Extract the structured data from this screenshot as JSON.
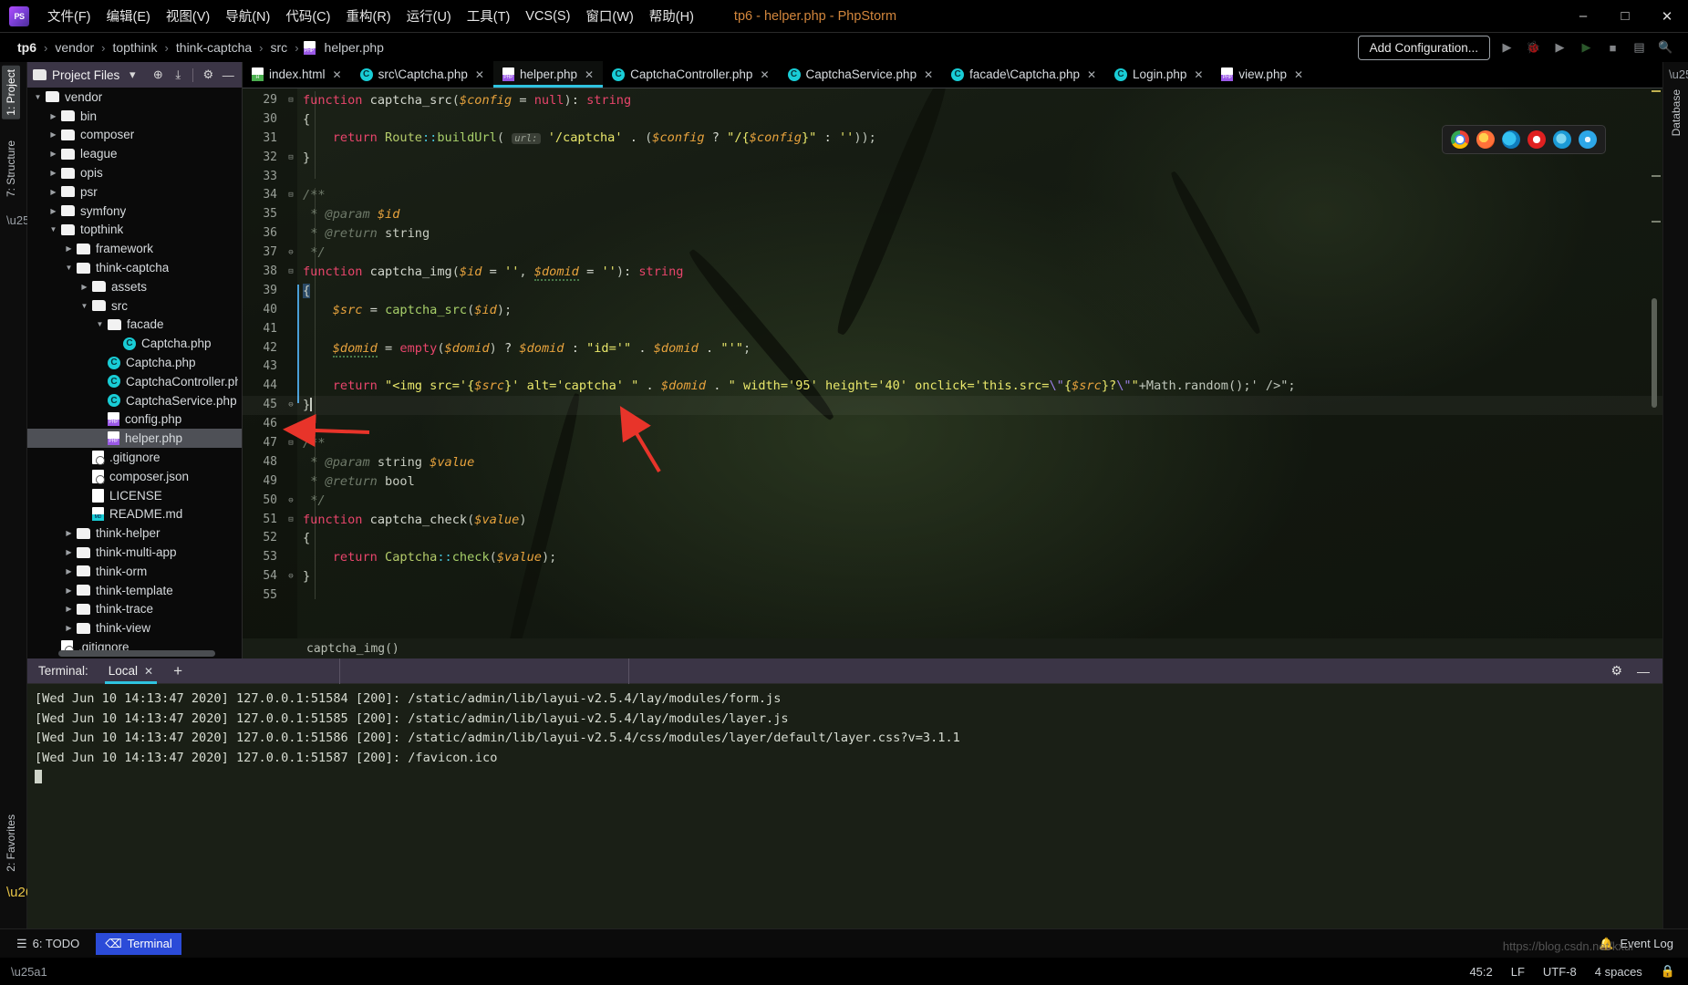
{
  "window": {
    "title": "tp6 - helper.php - PhpStorm",
    "logo_text": "PS",
    "minimize": "–",
    "maximize": "□",
    "close": "✕"
  },
  "menu": [
    {
      "label": "文件(F)",
      "name": "menu-file"
    },
    {
      "label": "编辑(E)",
      "name": "menu-edit"
    },
    {
      "label": "视图(V)",
      "name": "menu-view"
    },
    {
      "label": "导航(N)",
      "name": "menu-navigate"
    },
    {
      "label": "代码(C)",
      "name": "menu-code"
    },
    {
      "label": "重构(R)",
      "name": "menu-refactor"
    },
    {
      "label": "运行(U)",
      "name": "menu-run"
    },
    {
      "label": "工具(T)",
      "name": "menu-tools"
    },
    {
      "label": "VCS(S)",
      "name": "menu-vcs"
    },
    {
      "label": "窗口(W)",
      "name": "menu-window"
    },
    {
      "label": "帮助(H)",
      "name": "menu-help"
    }
  ],
  "breadcrumbs": {
    "items": [
      "tp6",
      "vendor",
      "topthink",
      "think-captcha",
      "src"
    ],
    "file": "helper.php",
    "separator": "›"
  },
  "toolbar": {
    "add_configuration": "Add Configuration...",
    "run": "▶",
    "debug": "🐞",
    "coverage": "▶",
    "profile": "▶",
    "stop": "■",
    "layout": "▤",
    "search": "🔍"
  },
  "left_stripe": {
    "project_tab": "1: Project",
    "structure_tab": "7: Structure",
    "favorites_tab": "2: Favorites"
  },
  "right_stripe": {
    "database_tab": "Database"
  },
  "project_panel": {
    "title": "Project Files",
    "dropdown_caret": "▾",
    "locate_icon": "⊕",
    "collapse_icon": "⤓",
    "settings_icon": "⚙",
    "hide_icon": "—",
    "tree": [
      {
        "label": "vendor",
        "indent": 1,
        "arrow": "down",
        "icon": "folder"
      },
      {
        "label": "bin",
        "indent": 2,
        "arrow": "right",
        "icon": "folder"
      },
      {
        "label": "composer",
        "indent": 2,
        "arrow": "right",
        "icon": "folder"
      },
      {
        "label": "league",
        "indent": 2,
        "arrow": "right",
        "icon": "folder"
      },
      {
        "label": "opis",
        "indent": 2,
        "arrow": "right",
        "icon": "folder"
      },
      {
        "label": "psr",
        "indent": 2,
        "arrow": "right",
        "icon": "folder"
      },
      {
        "label": "symfony",
        "indent": 2,
        "arrow": "right",
        "icon": "folder"
      },
      {
        "label": "topthink",
        "indent": 2,
        "arrow": "down",
        "icon": "folder"
      },
      {
        "label": "framework",
        "indent": 3,
        "arrow": "right",
        "icon": "folder"
      },
      {
        "label": "think-captcha",
        "indent": 3,
        "arrow": "down",
        "icon": "folder"
      },
      {
        "label": "assets",
        "indent": 4,
        "arrow": "right",
        "icon": "folder"
      },
      {
        "label": "src",
        "indent": 4,
        "arrow": "down",
        "icon": "folder"
      },
      {
        "label": "facade",
        "indent": 5,
        "arrow": "down",
        "icon": "folder"
      },
      {
        "label": "Captcha.php",
        "indent": 6,
        "arrow": "none",
        "icon": "class"
      },
      {
        "label": "Captcha.php",
        "indent": 5,
        "arrow": "none",
        "icon": "class"
      },
      {
        "label": "CaptchaController.php",
        "indent": 5,
        "arrow": "none",
        "icon": "class"
      },
      {
        "label": "CaptchaService.php",
        "indent": 5,
        "arrow": "none",
        "icon": "class"
      },
      {
        "label": "config.php",
        "indent": 5,
        "arrow": "none",
        "icon": "php"
      },
      {
        "label": "helper.php",
        "indent": 5,
        "arrow": "none",
        "icon": "php",
        "selected": true
      },
      {
        "label": ".gitignore",
        "indent": 4,
        "arrow": "none",
        "icon": "git"
      },
      {
        "label": "composer.json",
        "indent": 4,
        "arrow": "none",
        "icon": "git"
      },
      {
        "label": "LICENSE",
        "indent": 4,
        "arrow": "none",
        "icon": "license"
      },
      {
        "label": "README.md",
        "indent": 4,
        "arrow": "none",
        "icon": "md"
      },
      {
        "label": "think-helper",
        "indent": 3,
        "arrow": "right",
        "icon": "folder"
      },
      {
        "label": "think-multi-app",
        "indent": 3,
        "arrow": "right",
        "icon": "folder"
      },
      {
        "label": "think-orm",
        "indent": 3,
        "arrow": "right",
        "icon": "folder"
      },
      {
        "label": "think-template",
        "indent": 3,
        "arrow": "right",
        "icon": "folder"
      },
      {
        "label": "think-trace",
        "indent": 3,
        "arrow": "right",
        "icon": "folder"
      },
      {
        "label": "think-view",
        "indent": 3,
        "arrow": "right",
        "icon": "folder"
      },
      {
        "label": ".gitignore",
        "indent": 2,
        "arrow": "none",
        "icon": "git"
      }
    ]
  },
  "editor_tabs": [
    {
      "label": "index.html",
      "icon": "html",
      "active": false
    },
    {
      "label": "src\\Captcha.php",
      "icon": "class",
      "active": false
    },
    {
      "label": "helper.php",
      "icon": "php",
      "active": true
    },
    {
      "label": "CaptchaController.php",
      "icon": "class",
      "active": false
    },
    {
      "label": "CaptchaService.php",
      "icon": "class",
      "active": false
    },
    {
      "label": "facade\\Captcha.php",
      "icon": "class",
      "active": false
    },
    {
      "label": "Login.php",
      "icon": "class",
      "active": false
    },
    {
      "label": "view.php",
      "icon": "php",
      "active": false
    }
  ],
  "tab_close_glyph": "✕",
  "editor": {
    "first_line": 29,
    "breadcrumb": "captcha_img()",
    "lines": [
      {
        "n": 29,
        "fold": "⊟"
      },
      {
        "n": 30,
        "fold": ""
      },
      {
        "n": 31,
        "fold": ""
      },
      {
        "n": 32,
        "fold": "⊟"
      },
      {
        "n": 33,
        "fold": ""
      },
      {
        "n": 34,
        "fold": "⊟"
      },
      {
        "n": 35,
        "fold": ""
      },
      {
        "n": 36,
        "fold": ""
      },
      {
        "n": 37,
        "fold": "⊖"
      },
      {
        "n": 38,
        "fold": "⊟"
      },
      {
        "n": 39,
        "fold": ""
      },
      {
        "n": 40,
        "fold": ""
      },
      {
        "n": 41,
        "fold": ""
      },
      {
        "n": 42,
        "fold": ""
      },
      {
        "n": 43,
        "fold": ""
      },
      {
        "n": 44,
        "fold": ""
      },
      {
        "n": 45,
        "fold": "⊖",
        "current": true
      },
      {
        "n": 46,
        "fold": ""
      },
      {
        "n": 47,
        "fold": "⊟"
      },
      {
        "n": 48,
        "fold": ""
      },
      {
        "n": 49,
        "fold": ""
      },
      {
        "n": 50,
        "fold": "⊖"
      },
      {
        "n": 51,
        "fold": "⊟"
      },
      {
        "n": 52,
        "fold": ""
      },
      {
        "n": 53,
        "fold": ""
      },
      {
        "n": 54,
        "fold": "⊖"
      },
      {
        "n": 55,
        "fold": ""
      }
    ],
    "source_text": [
      "function captcha_src($config = null): string",
      "{",
      "    return Route::buildUrl( url: '/captcha' . ($config ? \"/{$config}\" : ''));",
      "}",
      "",
      "/**",
      " * @param $id",
      " * @return string",
      " */",
      "function captcha_img($id = '', $domid = ''): string",
      "{",
      "    $src = captcha_src($id);",
      "",
      "    $domid = empty($domid) ? $domid : \"id='\" . $domid . \"'\";",
      "",
      "    return \"<img src='{$src}' alt='captcha' \" . $domid . \" width='95' height='40' onclick='this.src=\\\"{$src}?\\\"+Math.random();' />\";",
      "}",
      "",
      "/**",
      " * @param string $value",
      " * @return bool",
      " */",
      "function captcha_check($value)",
      "{",
      "    return Captcha::check($value);",
      "}",
      ""
    ],
    "param_hint": "url:"
  },
  "terminal": {
    "label": "Terminal:",
    "tab": "Local",
    "tab_close": "✕",
    "add": "+",
    "settings_icon": "⚙",
    "hide_icon": "—",
    "lines": [
      "[Wed Jun 10 14:13:47 2020] 127.0.0.1:51584 [200]: /static/admin/lib/layui-v2.5.4/lay/modules/form.js",
      "[Wed Jun 10 14:13:47 2020] 127.0.0.1:51585 [200]: /static/admin/lib/layui-v2.5.4/lay/modules/layer.js",
      "[Wed Jun 10 14:13:47 2020] 127.0.0.1:51586 [200]: /static/admin/lib/layui-v2.5.4/css/modules/layer/default/layer.css?v=3.1.1",
      "[Wed Jun 10 14:13:47 2020] 127.0.0.1:51587 [200]: /favicon.ico"
    ]
  },
  "bottom_toolbar": {
    "todo": "6: TODO",
    "terminal": "Terminal",
    "event_log": "Event Log",
    "todo_icon": "☰",
    "terminal_icon": "⌫",
    "event_icon": "🔔"
  },
  "status_bar": {
    "caret_position": "45:2",
    "line_separator": "LF",
    "encoding": "UTF-8",
    "indent": "4 spaces",
    "lock_icon": "🔒",
    "watermark": "https://blog.csdn.net/kxul"
  },
  "colors": {
    "accent_cyan": "#2fc4e0",
    "title_orange": "#d2863c",
    "panel_purple": "#3b3546",
    "selection_blue": "#2b4bd8",
    "annotation_red": "#e8342a",
    "keyword_pink": "#e8456b",
    "string_yellow": "#eae86b",
    "variable_orange": "#e8a33d"
  }
}
